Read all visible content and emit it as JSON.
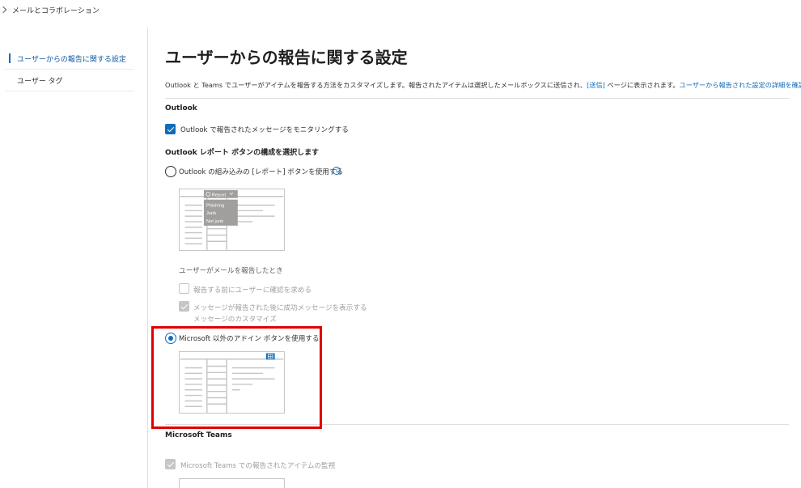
{
  "breadcrumb": {
    "label": "メールとコラボレーション"
  },
  "sidebar": {
    "items": [
      {
        "label": "ユーザーからの報告に関する設定",
        "active": true
      },
      {
        "label": "ユーザー タグ",
        "active": false
      }
    ]
  },
  "page": {
    "title": "ユーザーからの報告に関する設定",
    "description": {
      "text1": "Outlook と Teams でユーザーがアイテムを報告する方法をカスタマイズします。報告されたアイテムは選択したメールボックスに送信され、",
      "link1": "[送信]",
      "text2": " ページに表示されます。",
      "link2": "ユーザーから報告された設定の詳細を確認します。"
    }
  },
  "outlook": {
    "heading": "Outlook",
    "monitor_label": "Outlook で報告されたメッセージをモニタリングする",
    "monitor_checked": true,
    "config_heading": "Outlook レポート ボタンの構成を選択します",
    "builtin_option_label": "Outlook の組み込みの [レポート] ボタンを使用する",
    "builtin_selected": false,
    "report_menu": {
      "button": "Report",
      "items": [
        "Phishing",
        "Junk",
        "Not junk"
      ]
    },
    "when_reported_label": "ユーザーがメールを報告したとき",
    "confirm_label": "報告する前にユーザーに確認を求める",
    "confirm_checked": false,
    "success_label": "メッセージが報告された後に成功メッセージを表示する",
    "success_checked": true,
    "customize_label": "メッセージのカスタマイズ",
    "addin_option_label": "Microsoft 以外のアドイン ボタンを使用する",
    "addin_selected": true
  },
  "teams": {
    "heading": "Microsoft Teams",
    "monitor_label": "Microsoft Teams での報告されたアイテムの監視",
    "monitor_checked": true
  },
  "colors": {
    "accent": "#0f6cbd",
    "highlight": "#e00000"
  }
}
